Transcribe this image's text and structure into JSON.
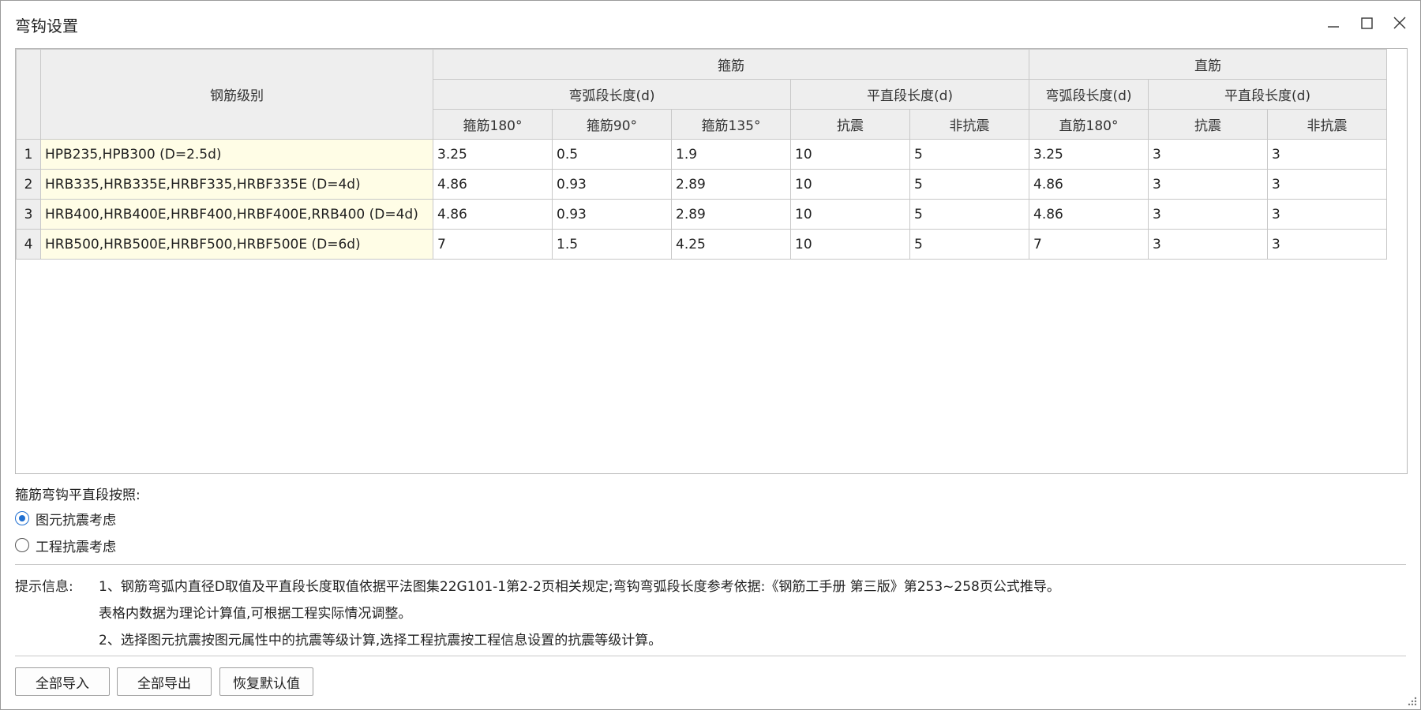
{
  "window": {
    "title": "弯钩设置"
  },
  "table": {
    "header": {
      "grade": "钢筋级别",
      "stirrup_group": "箍筋",
      "straight_group": "直筋",
      "stirrup_arc": "弯弧段长度(d)",
      "stirrup_flat": "平直段长度(d)",
      "straight_arc": "弯弧段长度(d)",
      "straight_flat": "平直段长度(d)",
      "cols": [
        "箍筋180°",
        "箍筋90°",
        "箍筋135°",
        "抗震",
        "非抗震",
        "直筋180°",
        "抗震",
        "非抗震"
      ]
    },
    "rows": [
      {
        "num": "1",
        "grade": "HPB235,HPB300 (D=2.5d)",
        "values": [
          "3.25",
          "0.5",
          "1.9",
          "10",
          "5",
          "3.25",
          "3",
          "3"
        ]
      },
      {
        "num": "2",
        "grade": "HRB335,HRB335E,HRBF335,HRBF335E (D=4d)",
        "values": [
          "4.86",
          "0.93",
          "2.89",
          "10",
          "5",
          "4.86",
          "3",
          "3"
        ]
      },
      {
        "num": "3",
        "grade": "HRB400,HRB400E,HRBF400,HRBF400E,RRB400 (D=4d)",
        "values": [
          "4.86",
          "0.93",
          "2.89",
          "10",
          "5",
          "4.86",
          "3",
          "3"
        ]
      },
      {
        "num": "4",
        "grade": "HRB500,HRB500E,HRBF500,HRBF500E (D=6d)",
        "values": [
          "7",
          "1.5",
          "4.25",
          "10",
          "5",
          "7",
          "3",
          "3"
        ]
      }
    ]
  },
  "options": {
    "label": "箍筋弯钩平直段按照:",
    "radio1": {
      "label": "图元抗震考虑",
      "checked": true
    },
    "radio2": {
      "label": "工程抗震考虑",
      "checked": false
    }
  },
  "tips": {
    "label": "提示信息:",
    "line1": "1、钢筋弯弧内直径D取值及平直段长度取值依据平法图集22G101-1第2-2页相关规定;弯钩弯弧段长度参考依据:《钢筋工手册 第三版》第253~258页公式推导。",
    "line2": "表格内数据为理论计算值,可根据工程实际情况调整。",
    "line3": "2、选择图元抗震按图元属性中的抗震等级计算,选择工程抗震按工程信息设置的抗震等级计算。"
  },
  "buttons": {
    "import": "全部导入",
    "export": "全部导出",
    "reset": "恢复默认值"
  },
  "colors": {
    "grade_cell_bg": "#fffde6",
    "header_bg": "#eeeeee",
    "radio_accent": "#1f6fd1"
  }
}
